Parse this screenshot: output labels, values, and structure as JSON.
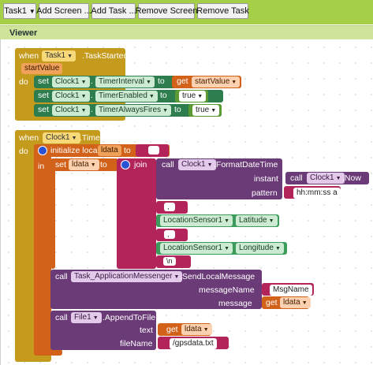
{
  "toolbar": {
    "task_select": "Task1",
    "add_screen": "Add Screen ...",
    "add_task": "Add Task ...",
    "remove_screen": "Remove Screen",
    "remove_task": "Remove Task"
  },
  "viewer": {
    "title": "Viewer"
  },
  "block1": {
    "when": "when",
    "component": "Task1",
    "event": ".TaskStarted",
    "param": "startValue",
    "do": "do",
    "rows": [
      {
        "set": "set",
        "comp": "Clock1",
        "prop": "TimerInterval",
        "to": "to",
        "value_prefix": "get",
        "value": "startValue"
      },
      {
        "set": "set",
        "comp": "Clock1",
        "prop": "TimerEnabled",
        "to": "to",
        "value": "true"
      },
      {
        "set": "set",
        "comp": "Clock1",
        "prop": "TimerAlwaysFires",
        "to": "to",
        "value": "true"
      }
    ]
  },
  "block2": {
    "when": "when",
    "component": "Clock1",
    "event": ".Timer",
    "do": "do",
    "init": "initialize local",
    "local_name": "ldata",
    "to": "to",
    "in": "in",
    "set": "set",
    "set_var": "ldata",
    "join": "join",
    "call": "call",
    "format_comp": "Clock1",
    "format_method": ".FormatDateTime",
    "instant": "instant",
    "now_comp": "Clock1",
    "now_method": ".Now",
    "pattern": "pattern",
    "pattern_value": "hh:mm:ss a",
    "sep1": ",",
    "loc1_comp": "LocationSensor1",
    "loc1_prop": "Latitude",
    "sep2": ",",
    "loc2_comp": "LocationSensor1",
    "loc2_prop": "Longitude",
    "newline": "\\n",
    "msg_comp": "Task_ApplicationMessenger",
    "msg_method": ".SendLocalMessage",
    "messageName": "messageName",
    "messageName_value": "MsgName",
    "message": "message",
    "message_get": "get",
    "message_var": "ldata",
    "file_comp": "File1",
    "file_method": ".AppendToFile",
    "text": "text",
    "text_get": "get",
    "text_var": "ldata",
    "fileName": "fileName",
    "fileName_value": "/gpsdata.txt"
  }
}
